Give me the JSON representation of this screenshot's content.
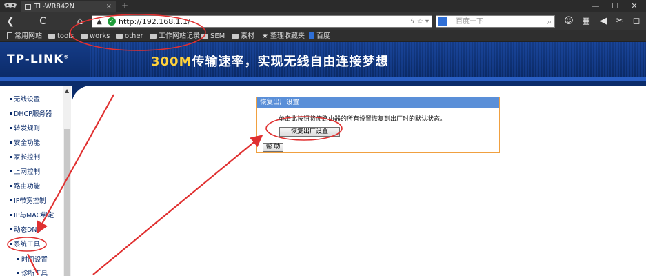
{
  "browser": {
    "tab_title": "TL-WR842N",
    "tab_close": "×",
    "new_tab": "+",
    "window_controls": [
      "—",
      "☐",
      "✕"
    ],
    "url": "http://192.168.1.1/",
    "search_placeholder": "百度一下",
    "nav_glyphs": {
      "back": "❮",
      "refresh": "C",
      "home": "⌂"
    },
    "url_right_glyphs": "ϟ  ☆  ▾",
    "search_glyph": "⌕",
    "toolbar_glyphs": [
      "☺",
      "▦",
      "◀",
      "✂",
      "◻"
    ]
  },
  "bookmarks": [
    "常用网站",
    "tools",
    "works",
    "other",
    "工作网站记录",
    "SEM",
    "素材",
    "整理收藏夹",
    "百度"
  ],
  "banner": {
    "logo": "TP-LINK",
    "logo_mark": "®",
    "slogan_number": "300M",
    "slogan_text": "传输速率，实现无线自由连接梦想"
  },
  "left_nav": {
    "items": [
      "无线设置",
      "DHCP服务器",
      "转发规则",
      "安全功能",
      "家长控制",
      "上网控制",
      "路由功能",
      "IP带宽控制",
      "IP与MAC绑定",
      "动态DNS",
      "系统工具"
    ],
    "sub_items": [
      "时间设置",
      "诊断工具"
    ],
    "scroll_up_glyph": "▲"
  },
  "panel": {
    "title": "恢复出厂设置",
    "description": "单击此按钮将使路由器的所有设置恢复到出厂时的默认状态。",
    "reset_button": "恢复出厂设置",
    "help_button": "帮 助"
  },
  "colors": {
    "router_blue": "#0b2c6b",
    "panel_header": "#5a8fd8",
    "panel_border": "#f0a040",
    "annotation_red": "#e03030"
  }
}
